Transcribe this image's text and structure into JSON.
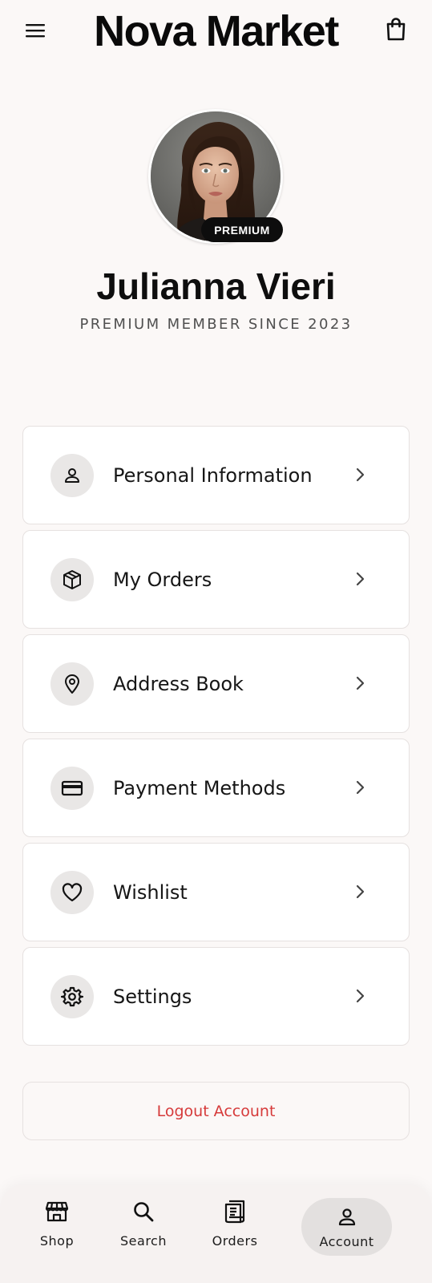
{
  "header": {
    "title": "Nova Market",
    "menu_icon": "hamburger-menu-icon",
    "cart_icon": "shopping-bag-icon"
  },
  "profile": {
    "name": "Julianna Vieri",
    "badge": "PREMIUM",
    "member_since": "PREMIUM MEMBER SINCE 2023",
    "avatar": "avatar-photo"
  },
  "menu": {
    "items": [
      {
        "label": "Personal Information",
        "icon": "person-icon"
      },
      {
        "label": "My Orders",
        "icon": "package-icon"
      },
      {
        "label": "Address Book",
        "icon": "location-pin-icon"
      },
      {
        "label": "Payment Methods",
        "icon": "credit-card-icon"
      },
      {
        "label": "Wishlist",
        "icon": "heart-icon"
      },
      {
        "label": "Settings",
        "icon": "gear-icon"
      }
    ]
  },
  "logout": {
    "label": "Logout Account",
    "color": "#d63a3a"
  },
  "bottom_nav": {
    "items": [
      {
        "label": "Shop",
        "icon": "storefront-icon"
      },
      {
        "label": "Search",
        "icon": "search-icon"
      },
      {
        "label": "Orders",
        "icon": "receipt-icon"
      },
      {
        "label": "Account",
        "icon": "person-icon",
        "active": true
      }
    ]
  },
  "colors": {
    "background": "#fbf8f7",
    "card": "#ffffff",
    "icon_circle": "#e9e7e6",
    "badge": "#0d0d0d",
    "logout_text": "#d63a3a",
    "nav_active_pill": "#e3e0df"
  }
}
